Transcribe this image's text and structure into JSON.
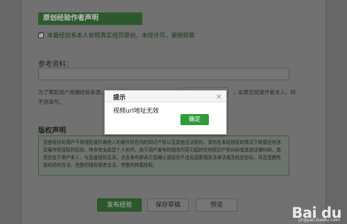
{
  "declaration": {
    "header": "原创经验作者声明",
    "checkbox_text": "本篇经验系本人依照真实经历原创，未经许可，谢绝转载",
    "checked": true
  },
  "reference": {
    "label": "参考资料：",
    "value": "",
    "help_text_1": "为了帮助用户准确经验来源，如",
    "help_text_2": "，如果您就是作者本人，则",
    "help_text_3": "不用填写。"
  },
  "copyright": {
    "label": "版权声明",
    "text": "百度经验的用户不得侵犯或抄袭他人的著作权在内的知识产权以及其他合法权利，请勿在未经授权的情况下转载任何涉及著作权侵权的经验，除非完全由您个人创作。由于用户发布的相关内容引起的任何知识产权纠纷或其他法律纠纷，其责任在于用户本人，与百度经验无关。点击发布即表示您确认该经验不违反国家相关法律法规及经验协议，并且您拥有该经验的合法、完整的版权或者合法、完整的转载授权。"
  },
  "buttons": {
    "publish": "发布经验",
    "save_draft": "保存草稿",
    "preview": "预览"
  },
  "dialog": {
    "title": "提示",
    "close_symbol": "×",
    "message": "视频url地址无效",
    "ok_label": "确定"
  },
  "watermark": {
    "logo": "Bai du",
    "subtitle": "jingyan.baidu.com"
  },
  "colors": {
    "accent_green": "#2d6a2d",
    "ok_button_green": "#2f9b3b"
  }
}
